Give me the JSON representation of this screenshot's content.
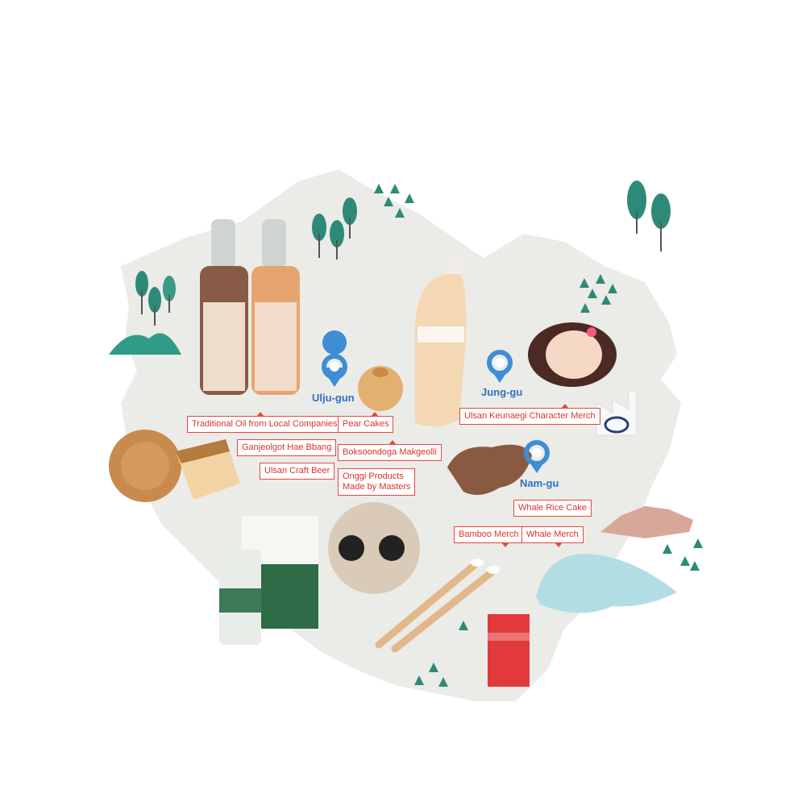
{
  "districts": {
    "ulju": "Ulju-gun",
    "jung": "Jung-gu",
    "nam": "Nam-gu"
  },
  "labels": {
    "traditional_oil": "Traditional Oil from Local Companies",
    "ganjeolgot": "Ganjeolgot Hae Bbang",
    "craft_beer": "Ulsan Craft Beer",
    "pear_cakes": "Pear Cakes",
    "makgeolli": "Boksoondoga Makgeolli",
    "onggi_line1": "Onggi Products",
    "onggi_line2": "Made by Masters",
    "keunaegi": "Ulsan Keunaegi Character Merch",
    "whale_rice_cake": "Whale Rice Cake",
    "bamboo": "Bamboo Merch",
    "whale_merch": "Whale Merch"
  },
  "colors": {
    "land": "#ebebe7",
    "label_border": "#e8483f",
    "district_text": "#2f72c4",
    "tree": "#2e8a78"
  },
  "icons": {
    "pin": "map-pin-icon",
    "tree": "tree-icon",
    "factory": "factory-icon",
    "hyundai_logo": "hyundai-logo"
  }
}
